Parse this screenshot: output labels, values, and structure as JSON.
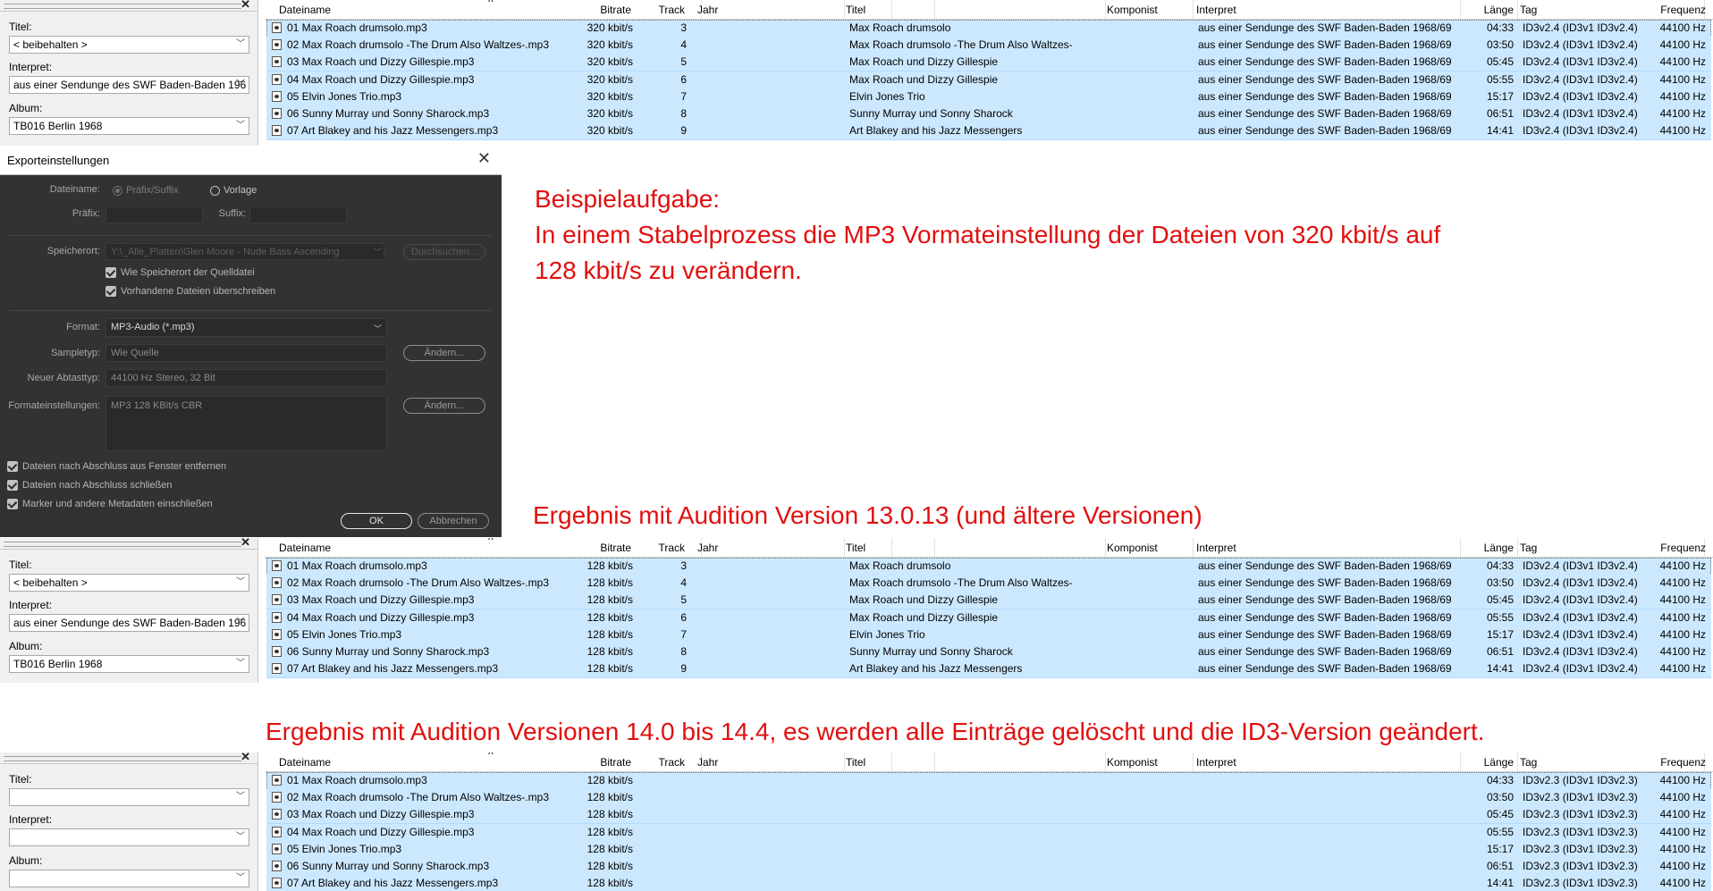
{
  "columns": {
    "dateiname": "Dateiname",
    "bitrate": "Bitrate",
    "track": "Track",
    "jahr": "Jahr",
    "titel": "Titel",
    "komponist": "Komponist",
    "interpret": "Interpret",
    "laenge": "Länge",
    "tag": "Tag",
    "frequenz": "Frequenz"
  },
  "tag_panel": {
    "titel_label": "Titel:",
    "interpret_label": "Interpret:",
    "album_label": "Album:",
    "titel_value": "< beibehalten >",
    "interpret_value": "aus einer Sendunge des SWF Baden-Baden 196",
    "album_value": "TB016 Berlin 1968"
  },
  "list1": [
    {
      "file": "01 Max Roach drumsolo.mp3",
      "bitrate": "320 kbit/s",
      "track": "3",
      "title": "Max Roach drumsolo",
      "interpret": "aus einer Sendunge des SWF Baden-Baden 1968/69",
      "length": "04:33",
      "tag": "ID3v2.4 (ID3v1 ID3v2.4)",
      "freq": "44100 Hz"
    },
    {
      "file": "02 Max Roach drumsolo -The Drum Also Waltzes-.mp3",
      "bitrate": "320 kbit/s",
      "track": "4",
      "title": "Max Roach drumsolo -The Drum Also Waltzes-",
      "interpret": "aus einer Sendunge des SWF Baden-Baden 1968/69",
      "length": "03:50",
      "tag": "ID3v2.4 (ID3v1 ID3v2.4)",
      "freq": "44100 Hz"
    },
    {
      "file": "03 Max Roach und Dizzy Gillespie.mp3",
      "bitrate": "320 kbit/s",
      "track": "5",
      "title": "Max Roach und Dizzy Gillespie",
      "interpret": "aus einer Sendunge des SWF Baden-Baden 1968/69",
      "length": "05:45",
      "tag": "ID3v2.4 (ID3v1 ID3v2.4)",
      "freq": "44100 Hz"
    },
    {
      "file": "04 Max Roach und Dizzy Gillespie.mp3",
      "bitrate": "320 kbit/s",
      "track": "6",
      "title": "Max Roach und Dizzy Gillespie",
      "interpret": "aus einer Sendunge des SWF Baden-Baden 1968/69",
      "length": "05:55",
      "tag": "ID3v2.4 (ID3v1 ID3v2.4)",
      "freq": "44100 Hz"
    },
    {
      "file": "05 Elvin Jones Trio.mp3",
      "bitrate": "320 kbit/s",
      "track": "7",
      "title": "Elvin Jones Trio",
      "interpret": "aus einer Sendunge des SWF Baden-Baden 1968/69",
      "length": "15:17",
      "tag": "ID3v2.4 (ID3v1 ID3v2.4)",
      "freq": "44100 Hz"
    },
    {
      "file": "06 Sunny Murray und Sonny Sharock.mp3",
      "bitrate": "320 kbit/s",
      "track": "8",
      "title": "Sunny Murray und Sonny Sharock",
      "interpret": "aus einer Sendunge des SWF Baden-Baden 1968/69",
      "length": "06:51",
      "tag": "ID3v2.4 (ID3v1 ID3v2.4)",
      "freq": "44100 Hz"
    },
    {
      "file": "07 Art Blakey and his Jazz Messengers.mp3",
      "bitrate": "320 kbit/s",
      "track": "9",
      "title": "Art Blakey and his Jazz Messengers",
      "interpret": "aus einer Sendunge des SWF Baden-Baden 1968/69",
      "length": "14:41",
      "tag": "ID3v2.4 (ID3v1 ID3v2.4)",
      "freq": "44100 Hz"
    }
  ],
  "list2": [
    {
      "file": "01 Max Roach drumsolo.mp3",
      "bitrate": "128 kbit/s",
      "track": "3",
      "title": "Max Roach drumsolo",
      "interpret": "aus einer Sendunge des SWF Baden-Baden 1968/69",
      "length": "04:33",
      "tag": "ID3v2.4 (ID3v1 ID3v2.4)",
      "freq": "44100 Hz"
    },
    {
      "file": "02 Max Roach drumsolo -The Drum Also Waltzes-.mp3",
      "bitrate": "128 kbit/s",
      "track": "4",
      "title": "Max Roach drumsolo -The Drum Also Waltzes-",
      "interpret": "aus einer Sendunge des SWF Baden-Baden 1968/69",
      "length": "03:50",
      "tag": "ID3v2.4 (ID3v1 ID3v2.4)",
      "freq": "44100 Hz"
    },
    {
      "file": "03 Max Roach und Dizzy Gillespie.mp3",
      "bitrate": "128 kbit/s",
      "track": "5",
      "title": "Max Roach und Dizzy Gillespie",
      "interpret": "aus einer Sendunge des SWF Baden-Baden 1968/69",
      "length": "05:45",
      "tag": "ID3v2.4 (ID3v1 ID3v2.4)",
      "freq": "44100 Hz"
    },
    {
      "file": "04 Max Roach und Dizzy Gillespie.mp3",
      "bitrate": "128 kbit/s",
      "track": "6",
      "title": "Max Roach und Dizzy Gillespie",
      "interpret": "aus einer Sendunge des SWF Baden-Baden 1968/69",
      "length": "05:55",
      "tag": "ID3v2.4 (ID3v1 ID3v2.4)",
      "freq": "44100 Hz"
    },
    {
      "file": "05 Elvin Jones Trio.mp3",
      "bitrate": "128 kbit/s",
      "track": "7",
      "title": "Elvin Jones Trio",
      "interpret": "aus einer Sendunge des SWF Baden-Baden 1968/69",
      "length": "15:17",
      "tag": "ID3v2.4 (ID3v1 ID3v2.4)",
      "freq": "44100 Hz"
    },
    {
      "file": "06 Sunny Murray und Sonny Sharock.mp3",
      "bitrate": "128 kbit/s",
      "track": "8",
      "title": "Sunny Murray und Sonny Sharock",
      "interpret": "aus einer Sendunge des SWF Baden-Baden 1968/69",
      "length": "06:51",
      "tag": "ID3v2.4 (ID3v1 ID3v2.4)",
      "freq": "44100 Hz"
    },
    {
      "file": "07 Art Blakey and his Jazz Messengers.mp3",
      "bitrate": "128 kbit/s",
      "track": "9",
      "title": "Art Blakey and his Jazz Messengers",
      "interpret": "aus einer Sendunge des SWF Baden-Baden 1968/69",
      "length": "14:41",
      "tag": "ID3v2.4 (ID3v1 ID3v2.4)",
      "freq": "44100 Hz"
    }
  ],
  "list3": [
    {
      "file": "01 Max Roach drumsolo.mp3",
      "bitrate": "128 kbit/s",
      "length": "04:33",
      "tag": "ID3v2.3 (ID3v1 ID3v2.3)",
      "freq": "44100 Hz"
    },
    {
      "file": "02 Max Roach drumsolo -The Drum Also Waltzes-.mp3",
      "bitrate": "128 kbit/s",
      "length": "03:50",
      "tag": "ID3v2.3 (ID3v1 ID3v2.3)",
      "freq": "44100 Hz"
    },
    {
      "file": "03 Max Roach und Dizzy Gillespie.mp3",
      "bitrate": "128 kbit/s",
      "length": "05:45",
      "tag": "ID3v2.3 (ID3v1 ID3v2.3)",
      "freq": "44100 Hz"
    },
    {
      "file": "04 Max Roach und Dizzy Gillespie.mp3",
      "bitrate": "128 kbit/s",
      "length": "05:55",
      "tag": "ID3v2.3 (ID3v1 ID3v2.3)",
      "freq": "44100 Hz"
    },
    {
      "file": "05 Elvin Jones Trio.mp3",
      "bitrate": "128 kbit/s",
      "length": "15:17",
      "tag": "ID3v2.3 (ID3v1 ID3v2.3)",
      "freq": "44100 Hz"
    },
    {
      "file": "06 Sunny Murray und Sonny Sharock.mp3",
      "bitrate": "128 kbit/s",
      "length": "06:51",
      "tag": "ID3v2.3 (ID3v1 ID3v2.3)",
      "freq": "44100 Hz"
    },
    {
      "file": "07 Art Blakey and his Jazz Messengers.mp3",
      "bitrate": "128 kbit/s",
      "length": "14:41",
      "tag": "ID3v2.3 (ID3v1 ID3v2.3)",
      "freq": "44100 Hz"
    }
  ],
  "dialog": {
    "title": "Exporteinstellungen",
    "dateiname_label": "Dateiname:",
    "radio_praefix": "Präfix/Suffix",
    "radio_vorlage": "Vorlage",
    "praefix_label": "Präfix:",
    "suffix_label": "Suffix:",
    "speicherort_label": "Speicherort:",
    "speicherort_value": "Y:\\_Alle_Platten\\Glen Moore - Nude Bass Ascending",
    "durchsuchen": "Durchsuchen...",
    "chk_wie_speicherort": "Wie Speicherort der Quelldatei",
    "chk_ueberschreiben": "Vorhandene Dateien überschreiben",
    "format_label": "Format:",
    "format_value": "MP3-Audio (*.mp3)",
    "sampletyp_label": "Sampletyp:",
    "sampletyp_value": "Wie Quelle",
    "aendern": "Ändern...",
    "abtasttyp_label": "Neuer Abtasttyp:",
    "abtasttyp_value": "44100 Hz Stereo, 32 Bit",
    "formateinstellungen_label": "Formateinstellungen:",
    "formateinstellungen_value": "MP3 128 KBit/s CBR",
    "chk_entfernen": "Dateien nach Abschluss aus Fenster entfernen",
    "chk_schliessen": "Dateien nach Abschluss schließen",
    "chk_marker": "Marker und andere Metadaten einschließen",
    "ok": "OK",
    "abbrechen": "Abbrechen"
  },
  "annotations": {
    "heading": "Beispielaufgabe:",
    "line1": "In einem Stabelprozess die MP3 Vormateinstellung der Dateien von 320 kbit/s auf",
    "line2": "128 kbit/s zu verändern.",
    "result1": "Ergebnis mit Audition Version 13.0.13 (und ältere Versionen)",
    "result2": "Ergebnis mit Audition Versionen 14.0  bis  14.4, es werden alle Einträge gelöscht und die ID3-Version geändert."
  },
  "colors": {
    "annotation_red": "#e0100f",
    "row_selected": "#cce8ff",
    "dialog_bg": "#323232"
  }
}
